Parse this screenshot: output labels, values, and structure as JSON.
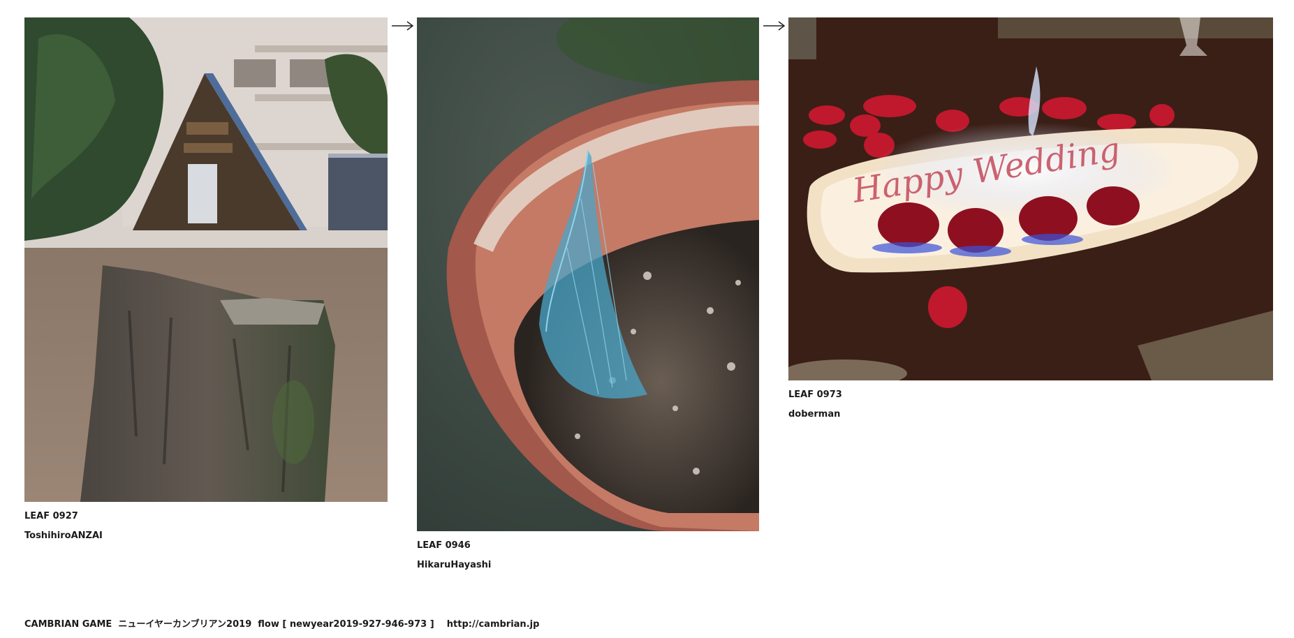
{
  "leaves": [
    {
      "caption": "LEAF 0927",
      "author": "ToshihiroANZAI"
    },
    {
      "caption": "LEAF 0946",
      "author": "HikaruHayashi"
    },
    {
      "caption": "LEAF 0973",
      "author": "doberman"
    }
  ],
  "photo_texts": {
    "leaf_0973_plate_writing": "Happy Wedding"
  },
  "footer": {
    "text": "CAMBRIAN GAME  ニューイヤーカンブリアン2019  flow [ newyear2019-927-946-973 ]    ",
    "link": "http://cambrian.jp"
  },
  "icons": {
    "next_arrow": "right-arrow-icon"
  }
}
